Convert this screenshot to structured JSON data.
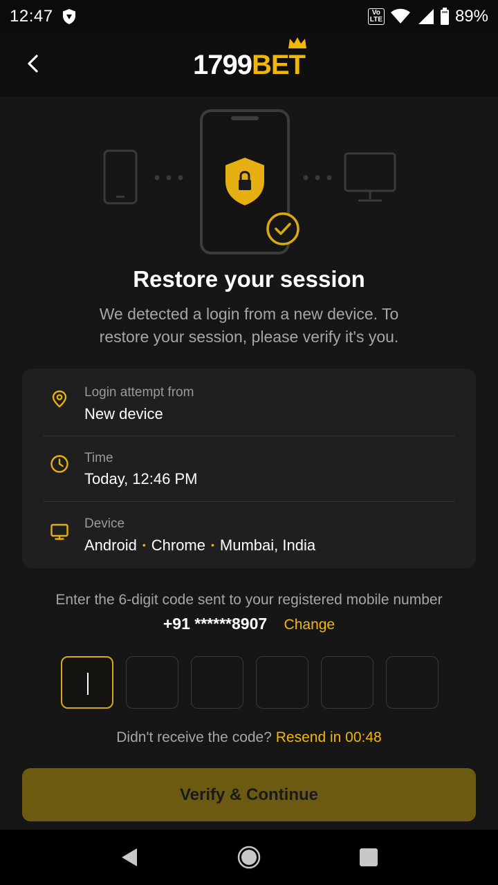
{
  "status_bar": {
    "time": "12:47",
    "volte": "Vo\nLTE",
    "battery": "89%"
  },
  "header": {
    "logo_number": "1799",
    "logo_brand": "BET"
  },
  "colors": {
    "accent": "#f2b705",
    "background": "#161616",
    "card": "#1f1f1f",
    "button_disabled": "#6b5a10"
  },
  "icons": {
    "back": "arrow-left-icon",
    "shield": "shield-lock-icon",
    "check": "check-circle-icon",
    "location": "location-pin-icon",
    "clock": "clock-icon",
    "monitor": "monitor-icon"
  },
  "content": {
    "title": "Restore your session",
    "subtitle": "We detected a login from a new device. To restore your session, please verify it's you."
  },
  "info": {
    "login_label": "Login attempt from",
    "login_value": "New device",
    "time_label": "Time",
    "time_value": "Today, 12:46 PM",
    "device_label": "Device",
    "device_os": "Android",
    "device_browser": "Chrome",
    "device_location": "Mumbai, India",
    "separator": "•"
  },
  "verification": {
    "instruction": "Enter the 6-digit code sent to your registered mobile number",
    "phone": "+91 ******8907",
    "change_label": "Change",
    "code_length": 6,
    "resend_prompt": "Didn't receive the code?",
    "resend_timer": "Resend in 00:48",
    "verify_label": "Verify & Continue"
  }
}
